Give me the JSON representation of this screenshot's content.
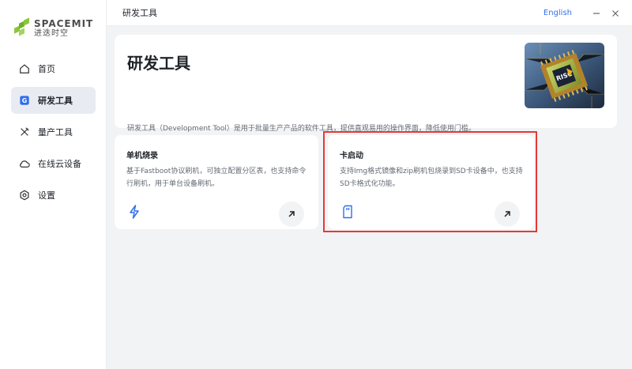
{
  "brand": {
    "name_en": "SPACEMIT",
    "name_cn": "进迭时空"
  },
  "sidebar": {
    "items": [
      {
        "label": "首页",
        "icon": "home-icon",
        "active": false
      },
      {
        "label": "研发工具",
        "icon": "dev-tool-icon",
        "active": true
      },
      {
        "label": "量产工具",
        "icon": "tools-icon",
        "active": false
      },
      {
        "label": "在线云设备",
        "icon": "cloud-icon",
        "active": false
      },
      {
        "label": "设置",
        "icon": "settings-icon",
        "active": false
      }
    ]
  },
  "topbar": {
    "page_title": "研发工具",
    "language": "English"
  },
  "hero": {
    "title": "研发工具",
    "description": "研发工具（Development Tool）是用于批量生产产品的软件工具，提供直观易用的操作界面，降低使用门槛。",
    "image": "risc-v-chip-image",
    "image_label": "RISC"
  },
  "cards": [
    {
      "title": "单机烧录",
      "description": "基于Fastboot协议刷机，可独立配置分区表，也支持命令行刷机，用于单台设备刷机。",
      "icon": "lightning-icon"
    },
    {
      "title": "卡启动",
      "description": "支持Img格式镜像和zip刷机包烧录到SD卡设备中，也支持SD卡格式化功能。",
      "icon": "sd-card-icon"
    }
  ],
  "colors": {
    "accent": "#2f6fed",
    "highlight": "#e53935",
    "logo_green": "#8cc63f"
  }
}
